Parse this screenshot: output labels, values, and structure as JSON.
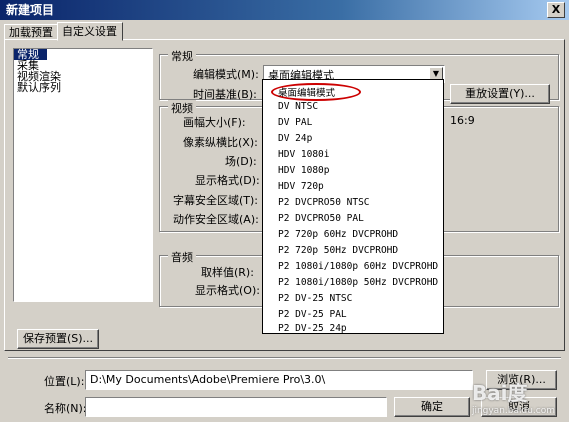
{
  "window": {
    "title": "新建项目",
    "close_glyph": "X"
  },
  "tabs": [
    {
      "label": "加载预置"
    },
    {
      "label": "自定义设置"
    }
  ],
  "nav": {
    "items": [
      "常规",
      "采集",
      "视频渲染",
      "默认序列"
    ]
  },
  "general": {
    "group_title": "常规",
    "edit_mode_label": "编辑模式(M):",
    "edit_mode_value": "桌面编辑模式",
    "timebase_label": "时间基准(B):",
    "reset_button": "重放设置(Y)..."
  },
  "video": {
    "group_title": "视频",
    "frame_size_label": "画幅大小(F):",
    "pixel_aspect_label": "像素纵横比(X):",
    "field_label": "场(D):",
    "display_format_label": "显示格式(D):",
    "title_safe_label": "字幕安全区域(T):",
    "action_safe_label": "动作安全区域(A):",
    "aspect_value": "16:9"
  },
  "audio": {
    "group_title": "音频",
    "sample_rate_label": "取样值(R):",
    "display_format_label": "显示格式(O):"
  },
  "dropdown_options": [
    "桌面编辑模式",
    "DV NTSC",
    "DV PAL",
    "DV 24p",
    "HDV 1080i",
    "HDV 1080p",
    "HDV 720p",
    "P2 DVCPRO50 NTSC",
    "P2 DVCPRO50 PAL",
    "P2 720p 60Hz DVCPROHD",
    "P2 720p 50Hz DVCPROHD",
    "P2 1080i/1080p 60Hz DVCPROHD",
    "P2 1080i/1080p 50Hz DVCPROHD",
    "P2 DV-25 NTSC",
    "P2 DV-25 PAL",
    "P2 DV-25 24p"
  ],
  "save_preset_button": "保存预置(S)...",
  "location": {
    "label": "位置(L):",
    "value": "D:\\My Documents\\Adobe\\Premiere Pro\\3.0\\",
    "browse_button": "浏览(R)..."
  },
  "name": {
    "label": "名称(N):",
    "value": ""
  },
  "ok_button": "确定",
  "cancel_button": "取消",
  "watermark": {
    "main": "Bai度",
    "sub": "jingyan.baidu.com"
  }
}
